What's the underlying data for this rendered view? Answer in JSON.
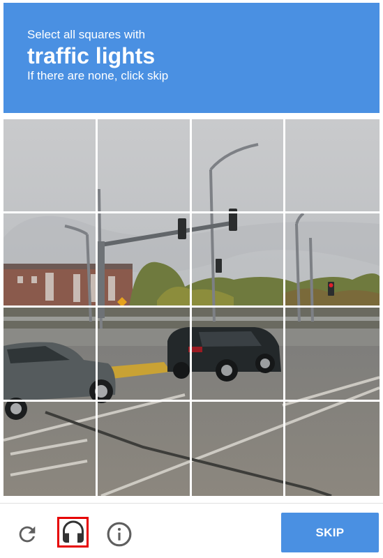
{
  "challenge": {
    "instruction_line1": "Select all squares with",
    "target_object": "traffic lights",
    "instruction_line3": "If there are none, click skip",
    "header_color": "#4a90e2"
  },
  "grid": {
    "rows": 4,
    "columns": 4,
    "image_description": "Street intersection with traffic light poles, street lamps, apartment building, trees, a grey SUV and a black SUV in a parking lot",
    "tiles": [
      {
        "row": 1,
        "col": 1,
        "selected": false
      },
      {
        "row": 1,
        "col": 2,
        "selected": false
      },
      {
        "row": 1,
        "col": 3,
        "selected": false
      },
      {
        "row": 1,
        "col": 4,
        "selected": false
      },
      {
        "row": 2,
        "col": 1,
        "selected": false
      },
      {
        "row": 2,
        "col": 2,
        "selected": false
      },
      {
        "row": 2,
        "col": 3,
        "selected": false
      },
      {
        "row": 2,
        "col": 4,
        "selected": false
      },
      {
        "row": 3,
        "col": 1,
        "selected": false
      },
      {
        "row": 3,
        "col": 2,
        "selected": false
      },
      {
        "row": 3,
        "col": 3,
        "selected": false
      },
      {
        "row": 3,
        "col": 4,
        "selected": false
      },
      {
        "row": 4,
        "col": 1,
        "selected": false
      },
      {
        "row": 4,
        "col": 2,
        "selected": false
      },
      {
        "row": 4,
        "col": 3,
        "selected": false
      },
      {
        "row": 4,
        "col": 4,
        "selected": false
      }
    ]
  },
  "footer": {
    "reload_icon": "reload-icon",
    "audio_icon": "headphones-icon",
    "audio_highlighted": true,
    "highlight_color": "#e60000",
    "info_icon": "info-icon",
    "skip_label": "SKIP",
    "skip_color": "#4a90e2"
  }
}
